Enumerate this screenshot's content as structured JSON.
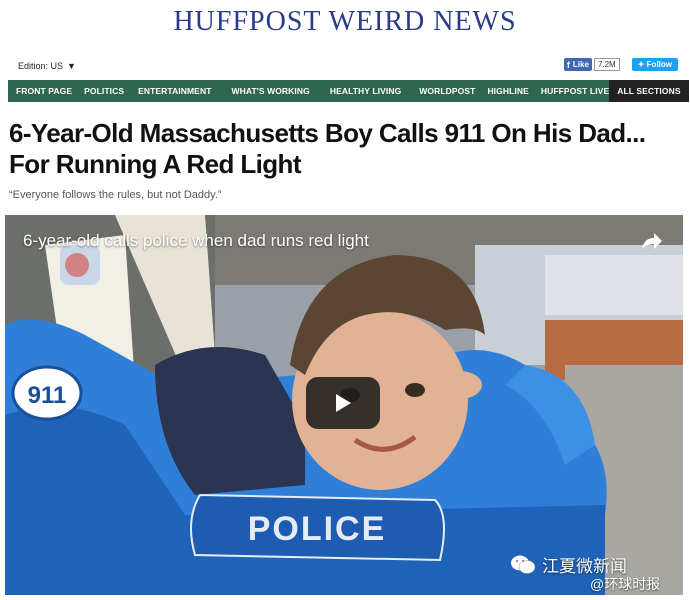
{
  "masthead": {
    "title": "HUFFPOST WEIRD NEWS"
  },
  "edition": {
    "label": "Edition: US"
  },
  "social": {
    "like_label": "Like",
    "like_count": "7.2M",
    "follow_label": "Follow"
  },
  "nav": {
    "items": [
      "FRONT PAGE",
      "POLITICS",
      "ENTERTAINMENT",
      "WHAT'S WORKING",
      "HEALTHY LIVING",
      "WORLDPOST",
      "HIGHLINE",
      "HUFFPOST LIVE",
      "ALL SECTIONS"
    ]
  },
  "article": {
    "headline_line1": "6-Year-Old Massachusetts Boy Calls 911 On His Dad...",
    "headline_line2": "For Running A Red Light",
    "dek": "“Everyone follows the rules, but not Daddy.”"
  },
  "video": {
    "title": "6-year-old calls police when dad runs red light",
    "car_number": "911",
    "car_label": "POLICE"
  },
  "watermark": {
    "account": "江夏微新闻",
    "source": "@环球时报"
  },
  "colors": {
    "masthead": "#2a3a8c",
    "nav_bg": "#2e6650",
    "car_blue": "#2f7fd9"
  }
}
